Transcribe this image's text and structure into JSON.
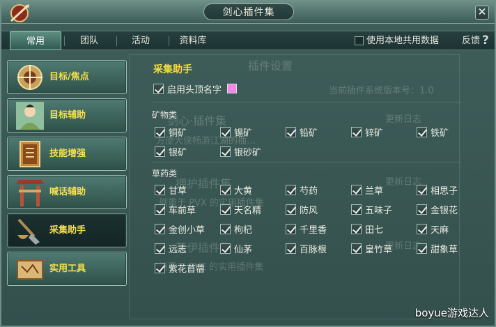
{
  "window": {
    "title": "剑心插件集",
    "close": "✕"
  },
  "tabs": [
    "常用",
    "团队",
    "活动",
    "资料库"
  ],
  "topbar": {
    "share_label": "使用本地共用数据",
    "feedback": "反馈",
    "help": "?"
  },
  "sidebar": {
    "items": [
      {
        "label": "目标/焦点",
        "icon": "target-emblem-icon",
        "active": false
      },
      {
        "label": "目标辅助",
        "icon": "character-portrait-icon",
        "active": false
      },
      {
        "label": "技能增强",
        "icon": "skill-book-icon",
        "active": false
      },
      {
        "label": "喊话辅助",
        "icon": "gate-archway-icon",
        "active": false
      },
      {
        "label": "采集助手",
        "icon": "shovel-basket-icon",
        "active": true
      },
      {
        "label": "实用工具",
        "icon": "scroll-map-icon",
        "active": false
      }
    ]
  },
  "panel": {
    "title": "采集助手",
    "show_name": {
      "label": "启用头顶名字",
      "checked": true,
      "color": "#f088e6"
    },
    "minerals": {
      "title": "矿物类",
      "items": [
        {
          "label": "铜矿",
          "checked": true
        },
        {
          "label": "锡矿",
          "checked": true
        },
        {
          "label": "铅矿",
          "checked": true
        },
        {
          "label": "锌矿",
          "checked": true
        },
        {
          "label": "铁矿",
          "checked": true
        },
        {
          "label": "银矿",
          "checked": true
        },
        {
          "label": "银砂矿",
          "checked": true
        }
      ]
    },
    "herbs": {
      "title": "草药类",
      "items": [
        {
          "label": "甘草",
          "checked": true
        },
        {
          "label": "大黄",
          "checked": true
        },
        {
          "label": "芍药",
          "checked": true
        },
        {
          "label": "兰草",
          "checked": true
        },
        {
          "label": "相思子",
          "checked": true
        },
        {
          "label": "车前草",
          "checked": true
        },
        {
          "label": "天名精",
          "checked": true
        },
        {
          "label": "防风",
          "checked": true
        },
        {
          "label": "五味子",
          "checked": true
        },
        {
          "label": "金银花",
          "checked": true
        },
        {
          "label": "金创小草",
          "checked": true
        },
        {
          "label": "枸杞",
          "checked": true
        },
        {
          "label": "千里香",
          "checked": true
        },
        {
          "label": "田七",
          "checked": true
        },
        {
          "label": "天麻",
          "checked": true
        },
        {
          "label": "远志",
          "checked": true
        },
        {
          "label": "仙茅",
          "checked": true
        },
        {
          "label": "百脉根",
          "checked": true
        },
        {
          "label": "皇竹草",
          "checked": true
        },
        {
          "label": "甜象草",
          "checked": true
        },
        {
          "label": "紫花苜蓿",
          "checked": true
        }
      ]
    }
  },
  "background": {
    "settings_title": "插件设置",
    "version_text": "当前插件系统版本号：1.0",
    "collections": [
      {
        "name": "剑心·插件集",
        "desc": "方便大侠畅游江湖的插…",
        "log": "更新日志"
      },
      {
        "name": "拥护插件集",
        "desc": "侧重于 PVX 的实用插件集",
        "log": "更新日志"
      },
      {
        "name": "茗伊插件集",
        "desc": "侧重于 PVE 的实用插件集",
        "log": "更新日志"
      }
    ]
  },
  "watermark": "boyue游戏达人"
}
